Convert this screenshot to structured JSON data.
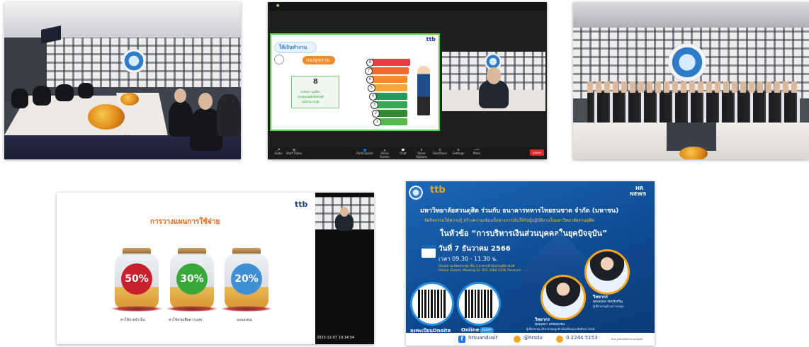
{
  "zoom": {
    "banner": "You are viewing 2023 HR Lecture 1 ...",
    "view_options": "View Options",
    "brand": "ttb",
    "slide_heading": "ให้เงินทำงาน",
    "slide_subheading": "กองทุนรวม",
    "slide_number": "8",
    "slide_caption_1": "ระดับความเสี่ยง",
    "slide_caption_2": "กองทุนอนุพันธ์/ทองคำ",
    "slide_caption_3": "น้อยไปมากสุด",
    "toolbar": [
      "Audio",
      "Start Video",
      "Participants",
      "Share Screen",
      "Chat",
      "Share Options",
      "Reactions",
      "Settings",
      "More"
    ],
    "leave": "Leave",
    "stair_numbers": [
      "8",
      "7",
      "6",
      "5",
      "4",
      "3",
      "2",
      "1"
    ]
  },
  "slide4": {
    "brand": "ttb",
    "title": "การวางแผนการใช้จ่าย",
    "jars": [
      {
        "pct": "50%",
        "label": "ค่าใช้จ่ายจำเป็น",
        "color": "#c9202e"
      },
      {
        "pct": "30%",
        "label": "ค่าใช้จ่ายเพื่อความสุข",
        "color": "#39a83b"
      },
      {
        "pct": "20%",
        "label": "ออมลงทุน",
        "color": "#3e8fd6"
      }
    ],
    "timestamp": "2023-12-07  10:14:54"
  },
  "poster": {
    "hr": "HR",
    "news": "NEWS",
    "brand": "ttb",
    "headline": "มหาวิทยาลัยสวนดุสิต ร่วมกับ ธนาคารทหารไทยธนชาต จำกัด (มหาชน)",
    "subheadline": "จัดกิจกรรมให้ความรู้ สร้างความเข้มแข็งทางการเงินให้กับผู้ปฏิบัติงานในมหาวิทยาลัยสวนดุสิต",
    "topic": "ในหัวข้อ “การบริหารเงินส่วนบุคคลในยุคปัจจุบัน”",
    "date": "วันที่ 7 ธันวาคม 2566",
    "time": "เวลา 09.30 - 11.30 น.",
    "onsite_line": "Onsite ณ ห้องประชุม ชั้น 3 อาคารสำนักงานอธิการบดี",
    "online_line": "Online (Zoom) Meeting ID: 955 5984 0356  Passcode: sdu",
    "onsite_label": "ลงทะเบียนOnsite",
    "online_label": "Online",
    "zoom_label": "zoom",
    "speaker1_role": "วิทยากร",
    "speaker1_name": "คุณบุษบา อภัยผดุงชน",
    "speaker1_title": "ผู้เชี่ยวชาญ บริหารกลุ่มลูกค้าเงินเดือนและสิทธิประโยชน์",
    "speaker2_role": "วิทยากร",
    "speaker2_name": "คุณนฤพล จันทร์เจริญ",
    "speaker2_title": "ผู้เชี่ยวชาญด้านการลงทุน",
    "footer": [
      "hrsuandusit",
      "@hrsdu",
      "0 2244 5153"
    ],
    "footer_note": "ฝ่าย รูปลักษณ์/นำส่วนกลยุทธ์"
  }
}
